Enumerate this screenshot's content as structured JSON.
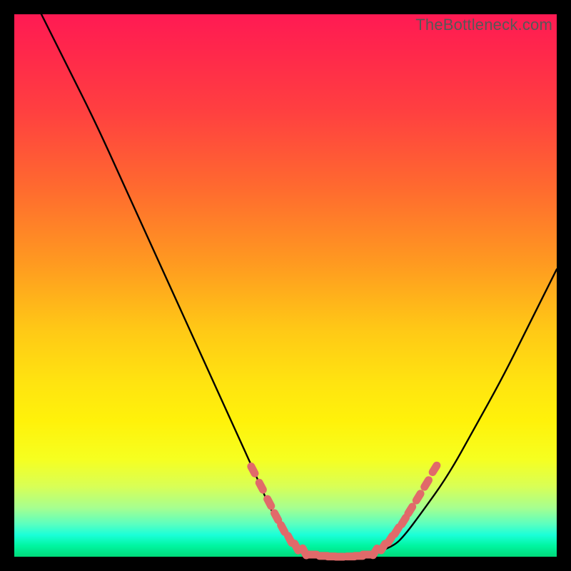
{
  "attribution": "TheBottleneck.com",
  "chart_data": {
    "type": "line",
    "title": "",
    "xlabel": "",
    "ylabel": "",
    "xlim": [
      0,
      100
    ],
    "ylim": [
      0,
      100
    ],
    "grid": false,
    "legend": false,
    "series": [
      {
        "name": "curve",
        "x": [
          5,
          10,
          15,
          20,
          25,
          30,
          35,
          40,
          45,
          48,
          52,
          55,
          58,
          62,
          66,
          70,
          72,
          75,
          80,
          85,
          90,
          95,
          100
        ],
        "y": [
          100,
          90,
          80,
          69,
          58,
          47,
          36,
          25,
          14,
          7,
          2,
          0.5,
          0,
          0,
          0.5,
          2,
          4,
          8,
          15,
          24,
          33,
          43,
          53
        ]
      }
    ],
    "markers": {
      "name": "highlight-dots",
      "color": "#e16a6a",
      "points": [
        {
          "x": 44,
          "y": 16
        },
        {
          "x": 45.5,
          "y": 13
        },
        {
          "x": 47,
          "y": 10
        },
        {
          "x": 48.3,
          "y": 7.4
        },
        {
          "x": 49.5,
          "y": 5.2
        },
        {
          "x": 50.8,
          "y": 3.2
        },
        {
          "x": 52,
          "y": 1.8
        },
        {
          "x": 53.5,
          "y": 0.9
        },
        {
          "x": 55,
          "y": 0.4
        },
        {
          "x": 57,
          "y": 0.15
        },
        {
          "x": 58.5,
          "y": 0.05
        },
        {
          "x": 60,
          "y": 0
        },
        {
          "x": 62,
          "y": 0.05
        },
        {
          "x": 63.5,
          "y": 0.15
        },
        {
          "x": 65,
          "y": 0.4
        },
        {
          "x": 66.5,
          "y": 0.9
        },
        {
          "x": 68,
          "y": 1.8
        },
        {
          "x": 69.3,
          "y": 3.2
        },
        {
          "x": 70.5,
          "y": 4.8
        },
        {
          "x": 71.8,
          "y": 6.6
        },
        {
          "x": 73,
          "y": 8.6
        },
        {
          "x": 74.5,
          "y": 11
        },
        {
          "x": 76,
          "y": 13.5
        },
        {
          "x": 77.5,
          "y": 16.2
        }
      ]
    },
    "gradient_bands": [
      {
        "position": 0.0,
        "color": "#ff1a53"
      },
      {
        "position": 0.5,
        "color": "#ffc816"
      },
      {
        "position": 0.8,
        "color": "#fff20a"
      },
      {
        "position": 0.95,
        "color": "#1affd8"
      },
      {
        "position": 1.0,
        "color": "#00d97a"
      }
    ]
  }
}
